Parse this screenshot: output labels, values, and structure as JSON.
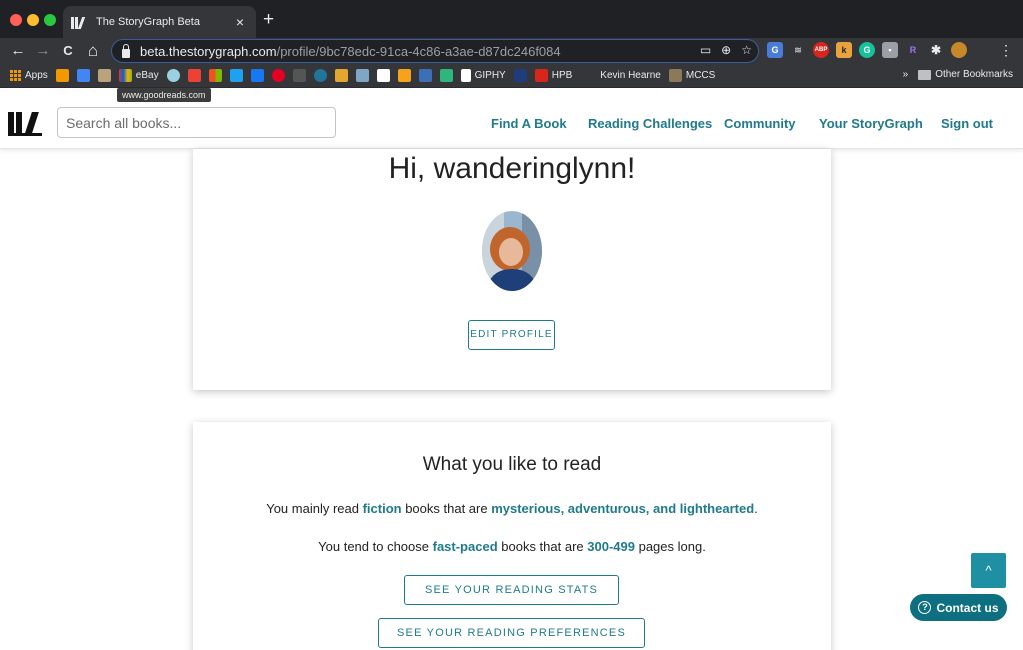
{
  "browser": {
    "tab_title": "The StoryGraph Beta",
    "tab_close": "×",
    "new_tab": "+",
    "url_host": "beta.thestorygraph.com",
    "url_path": "/profile/9bc78edc-91ca-4c86-a3ae-d87dc246f084",
    "back": "←",
    "forward": "→",
    "reload": "C",
    "home": "⌂",
    "menu": "⋮",
    "bookmarks": {
      "apps": "Apps",
      "ebay": "eBay",
      "giphy": "GIPHY",
      "hpb": "HPB",
      "kevin": "Kevin Hearne",
      "mccs": "MCCS",
      "overflow": "»",
      "other": "Other Bookmarks"
    },
    "tooltip": "www.goodreads.com"
  },
  "header": {
    "search_placeholder": "Search all books...",
    "nav": {
      "find": "Find A Book",
      "challenges": "Reading Challenges",
      "community": "Community",
      "storygraph": "Your StoryGraph",
      "signout": "Sign out"
    }
  },
  "profile": {
    "greeting": "Hi, wanderinglynn!",
    "edit_button": "EDIT PROFILE"
  },
  "reading": {
    "title": "What you like to read",
    "p1_a": "You mainly read ",
    "p1_genre": "fiction",
    "p1_b": " books that are ",
    "p1_moods": "mysterious, adventurous, and lighthearted",
    "p1_c": ".",
    "p2_a": "You tend to choose ",
    "p2_pace": "fast-paced",
    "p2_b": " books that are ",
    "p2_pages": "300-499",
    "p2_c": " pages long.",
    "stats_button": "SEE YOUR READING STATS",
    "prefs_button": "SEE YOUR READING PREFERENCES"
  },
  "widgets": {
    "scroll_top": "^",
    "contact": "Contact us",
    "contact_icon": "?"
  },
  "colors": {
    "accent": "#1f7a8c",
    "scroll_button": "#1f8fa3",
    "contact_button": "#0e6f80"
  }
}
